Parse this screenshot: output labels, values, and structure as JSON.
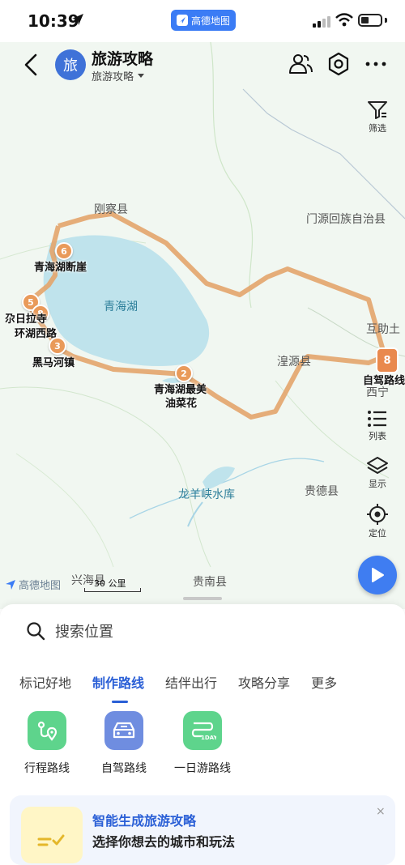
{
  "status": {
    "time": "10:39",
    "center_badge": "高德地图"
  },
  "header": {
    "avatar_text": "旅",
    "title": "旅游攻略",
    "subtitle": "旅游攻略"
  },
  "map": {
    "place_labels": {
      "gangcha": "刚察县",
      "menyuan": "门源回族自治县",
      "huzhu": "互助土",
      "qinghai_lake": "青海湖",
      "huangyuan": "湟源县",
      "xining": "西宁",
      "longyangxia": "龙羊峡水库",
      "guide": "贵德县",
      "xinghai": "兴海县",
      "guinan": "贵南县"
    },
    "spots": [
      {
        "num": "6",
        "label": "青海湖断崖"
      },
      {
        "num": "5",
        "label": "尕日拉寺"
      },
      {
        "num": "4",
        "label": "环湖西路"
      },
      {
        "num": "3",
        "label": "黑马河镇"
      },
      {
        "num": "2",
        "label": "青海湖最美\n油菜花"
      },
      {
        "num": "8",
        "label": "自驾路线"
      }
    ],
    "spot_4_label": "环湖西路",
    "spot_2_line1": "青海湖最美",
    "spot_2_line2": "油菜花",
    "scale": "30 公里",
    "logo": "高德地图",
    "colors": {
      "route": "#e3a46b",
      "lake": "#bfe3ec",
      "land": "#f1f7f1",
      "accent": "#2a5fd6"
    }
  },
  "tools": {
    "filter": "筛选",
    "list": "列表",
    "display": "显示",
    "locate": "定位"
  },
  "search": {
    "placeholder": "搜索位置"
  },
  "tabs": [
    "标记好地",
    "制作路线",
    "结伴出行",
    "攻略分享",
    "更多"
  ],
  "active_tab": "制作路线",
  "features": [
    {
      "label": "行程路线",
      "icon": "route-pin-icon",
      "color": "#5ed48c"
    },
    {
      "label": "自驾路线",
      "icon": "car-icon",
      "color": "#6f8de0"
    },
    {
      "label": "一日游路线",
      "icon": "one-day-icon",
      "color": "#5ed48c"
    }
  ],
  "ai_card": {
    "title": "智能生成旅游攻略",
    "subtitle": "选择你想去的城市和玩法",
    "close": "×"
  }
}
